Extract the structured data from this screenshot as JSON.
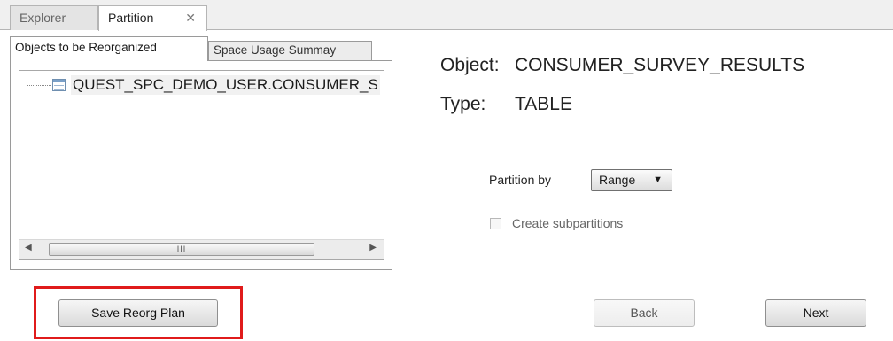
{
  "doc_tabs": [
    {
      "label": "Explorer"
    },
    {
      "label": "Partition",
      "close": "✕"
    }
  ],
  "inner_tabs": [
    {
      "label": "Objects to be Reorganized"
    },
    {
      "label": "Space Usage Summay"
    }
  ],
  "tree": {
    "item_label": "QUEST_SPC_DEMO_USER.CONSUMER_S",
    "scroll_left": "◀",
    "scroll_right": "▶",
    "scroll_grip": "III"
  },
  "details": {
    "object_label": "Object:",
    "object_value": "CONSUMER_SURVEY_RESULTS",
    "type_label": "Type:",
    "type_value": "TABLE"
  },
  "partition": {
    "label": "Partition by",
    "selected": "Range",
    "caret": "▼",
    "subpartitions_label": "Create subpartitions",
    "subpartitions_checked": false,
    "subpartitions_enabled": false
  },
  "buttons": {
    "save": "Save Reorg Plan",
    "back": "Back",
    "next": "Next"
  },
  "colors": {
    "highlight": "#e01b1b"
  }
}
